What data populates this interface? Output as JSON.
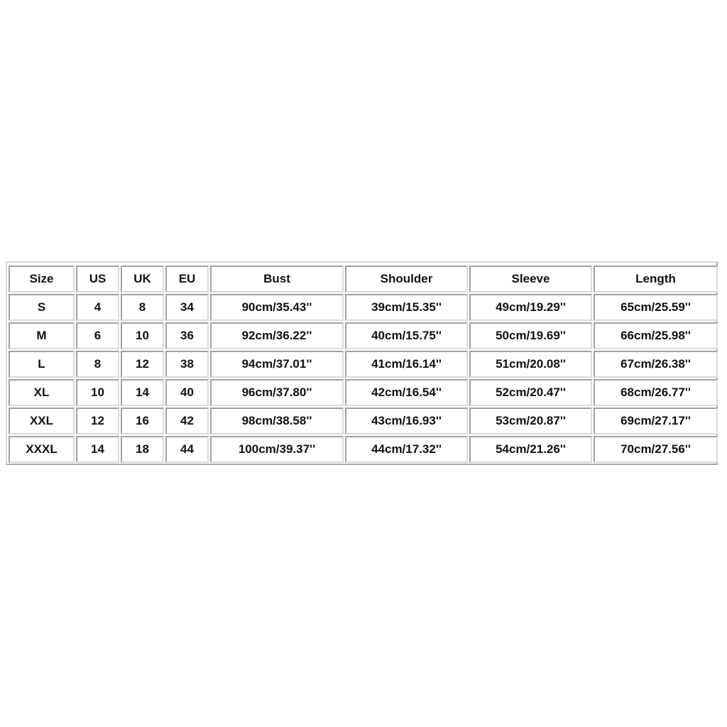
{
  "size_chart": {
    "headers": [
      "Size",
      "US",
      "UK",
      "EU",
      "Bust",
      "Shoulder",
      "Sleeve",
      "Length"
    ],
    "rows": [
      [
        "S",
        "4",
        "8",
        "34",
        "90cm/35.43''",
        "39cm/15.35''",
        "49cm/19.29''",
        "65cm/25.59''"
      ],
      [
        "M",
        "6",
        "10",
        "36",
        "92cm/36.22''",
        "40cm/15.75''",
        "50cm/19.69''",
        "66cm/25.98''"
      ],
      [
        "L",
        "8",
        "12",
        "38",
        "94cm/37.01''",
        "41cm/16.14''",
        "51cm/20.08''",
        "67cm/26.38''"
      ],
      [
        "XL",
        "10",
        "14",
        "40",
        "96cm/37.80''",
        "42cm/16.54''",
        "52cm/20.47''",
        "68cm/26.77''"
      ],
      [
        "XXL",
        "12",
        "16",
        "42",
        "98cm/38.58''",
        "43cm/16.93''",
        "53cm/20.87''",
        "69cm/27.17''"
      ],
      [
        "XXXL",
        "14",
        "18",
        "44",
        "100cm/39.37''",
        "44cm/17.32''",
        "54cm/21.26''",
        "70cm/27.56''"
      ]
    ]
  }
}
